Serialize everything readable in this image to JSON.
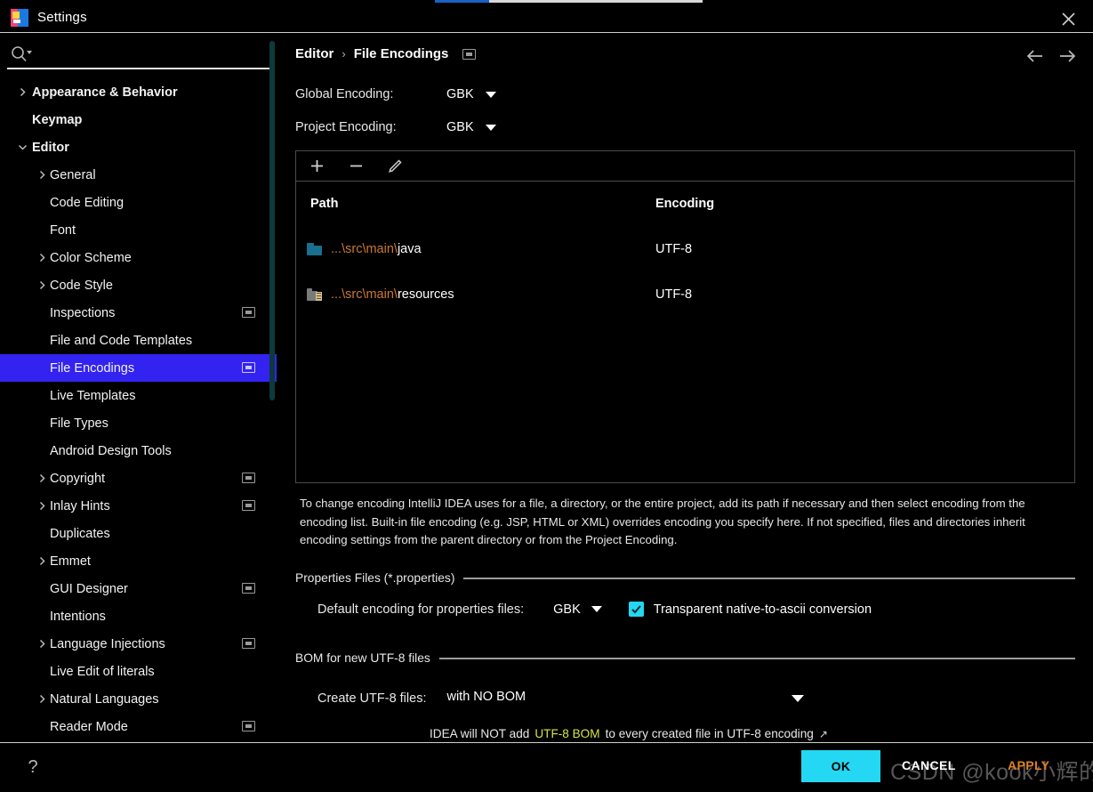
{
  "window": {
    "title": "Settings",
    "close_icon": "close-icon",
    "logo_icon": "intellij-idea-logo-icon"
  },
  "search": {
    "value": "",
    "placeholder": "",
    "icon": "search-icon"
  },
  "sidebar": {
    "items": [
      {
        "label": "Appearance & Behavior",
        "level": 0,
        "chevron": "chevron-right",
        "badge": false
      },
      {
        "label": "Keymap",
        "level": 0,
        "chevron": "none",
        "badge": false
      },
      {
        "label": "Editor",
        "level": 0,
        "chevron": "chevron-down",
        "badge": false
      },
      {
        "label": "General",
        "level": 1,
        "chevron": "chevron-right",
        "badge": false
      },
      {
        "label": "Code Editing",
        "level": 1,
        "chevron": "none",
        "badge": false
      },
      {
        "label": "Font",
        "level": 1,
        "chevron": "none",
        "badge": false
      },
      {
        "label": "Color Scheme",
        "level": 1,
        "chevron": "chevron-right",
        "badge": false
      },
      {
        "label": "Code Style",
        "level": 1,
        "chevron": "chevron-right",
        "badge": false
      },
      {
        "label": "Inspections",
        "level": 1,
        "chevron": "none",
        "badge": true
      },
      {
        "label": "File and Code Templates",
        "level": 1,
        "chevron": "none",
        "badge": false
      },
      {
        "label": "File Encodings",
        "level": 1,
        "chevron": "none",
        "badge": true,
        "selected": true
      },
      {
        "label": "Live Templates",
        "level": 1,
        "chevron": "none",
        "badge": false
      },
      {
        "label": "File Types",
        "level": 1,
        "chevron": "none",
        "badge": false
      },
      {
        "label": "Android Design Tools",
        "level": 1,
        "chevron": "none",
        "badge": false
      },
      {
        "label": "Copyright",
        "level": 1,
        "chevron": "chevron-right",
        "badge": true
      },
      {
        "label": "Inlay Hints",
        "level": 1,
        "chevron": "chevron-right",
        "badge": true
      },
      {
        "label": "Duplicates",
        "level": 1,
        "chevron": "none",
        "badge": false
      },
      {
        "label": "Emmet",
        "level": 1,
        "chevron": "chevron-right",
        "badge": false
      },
      {
        "label": "GUI Designer",
        "level": 1,
        "chevron": "none",
        "badge": true
      },
      {
        "label": "Intentions",
        "level": 1,
        "chevron": "none",
        "badge": false
      },
      {
        "label": "Language Injections",
        "level": 1,
        "chevron": "chevron-right",
        "badge": true
      },
      {
        "label": "Live Edit of literals",
        "level": 1,
        "chevron": "none",
        "badge": false
      },
      {
        "label": "Natural Languages",
        "level": 1,
        "chevron": "chevron-right",
        "badge": false
      },
      {
        "label": "Reader Mode",
        "level": 1,
        "chevron": "none",
        "badge": true
      }
    ]
  },
  "content": {
    "breadcrumb": {
      "parent": "Editor",
      "separator": "›",
      "current": "File Encodings"
    },
    "nav": {
      "back_icon": "arrow-left-icon",
      "forward_icon": "arrow-right-icon"
    },
    "global_encoding": {
      "label": "Global Encoding:",
      "value": "GBK"
    },
    "project_encoding": {
      "label": "Project Encoding:",
      "value": "GBK"
    },
    "toolbar": {
      "add_icon": "plus-icon",
      "remove_icon": "minus-icon",
      "edit_icon": "pencil-icon"
    },
    "table": {
      "columns": [
        "Path",
        "Encoding"
      ],
      "rows": [
        {
          "path_prefix": "...\\src\\main\\",
          "path_last": "java",
          "encoding": "UTF-8",
          "icon": "folder-icon"
        },
        {
          "path_prefix": "...\\src\\main\\",
          "path_last": "resources",
          "encoding": "UTF-8",
          "icon": "resources-folder-icon"
        }
      ]
    },
    "description": "To change encoding IntelliJ IDEA uses for a file, a directory, or the entire project, add its path if necessary and then select encoding from the encoding list. Built-in file encoding (e.g. JSP, HTML or XML) overrides encoding you specify here. If not specified, files and directories inherit encoding settings from the parent directory or from the Project Encoding.",
    "properties_section": {
      "title": "Properties Files (*.properties)",
      "default_encoding_label": "Default encoding for properties files:",
      "default_encoding_value": "GBK",
      "transparent_label": "Transparent native-to-ascii conversion",
      "transparent_checked": true
    },
    "bom_section": {
      "title": "BOM for new UTF-8 files",
      "create_label": "Create UTF-8 files:",
      "create_value": "with NO BOM",
      "hint_before": "IDEA will NOT add ",
      "hint_highlight": "UTF-8 BOM",
      "hint_after": " to every created file in UTF-8 encoding",
      "hint_external_icon": "↗"
    }
  },
  "footer": {
    "help_label": "?",
    "ok_label": "OK",
    "cancel_label": "CANCEL",
    "apply_label": "APPLY",
    "watermark": "CSDN @kook小辉的进阶"
  },
  "colors": {
    "selection": "#3323f0",
    "accent_cyan": "#24d7f2",
    "path_prefix": "#cc7832",
    "apply_orange": "#e08020",
    "bom_highlight": "#d6e24a",
    "folder_blue": "#1a6e8e"
  }
}
